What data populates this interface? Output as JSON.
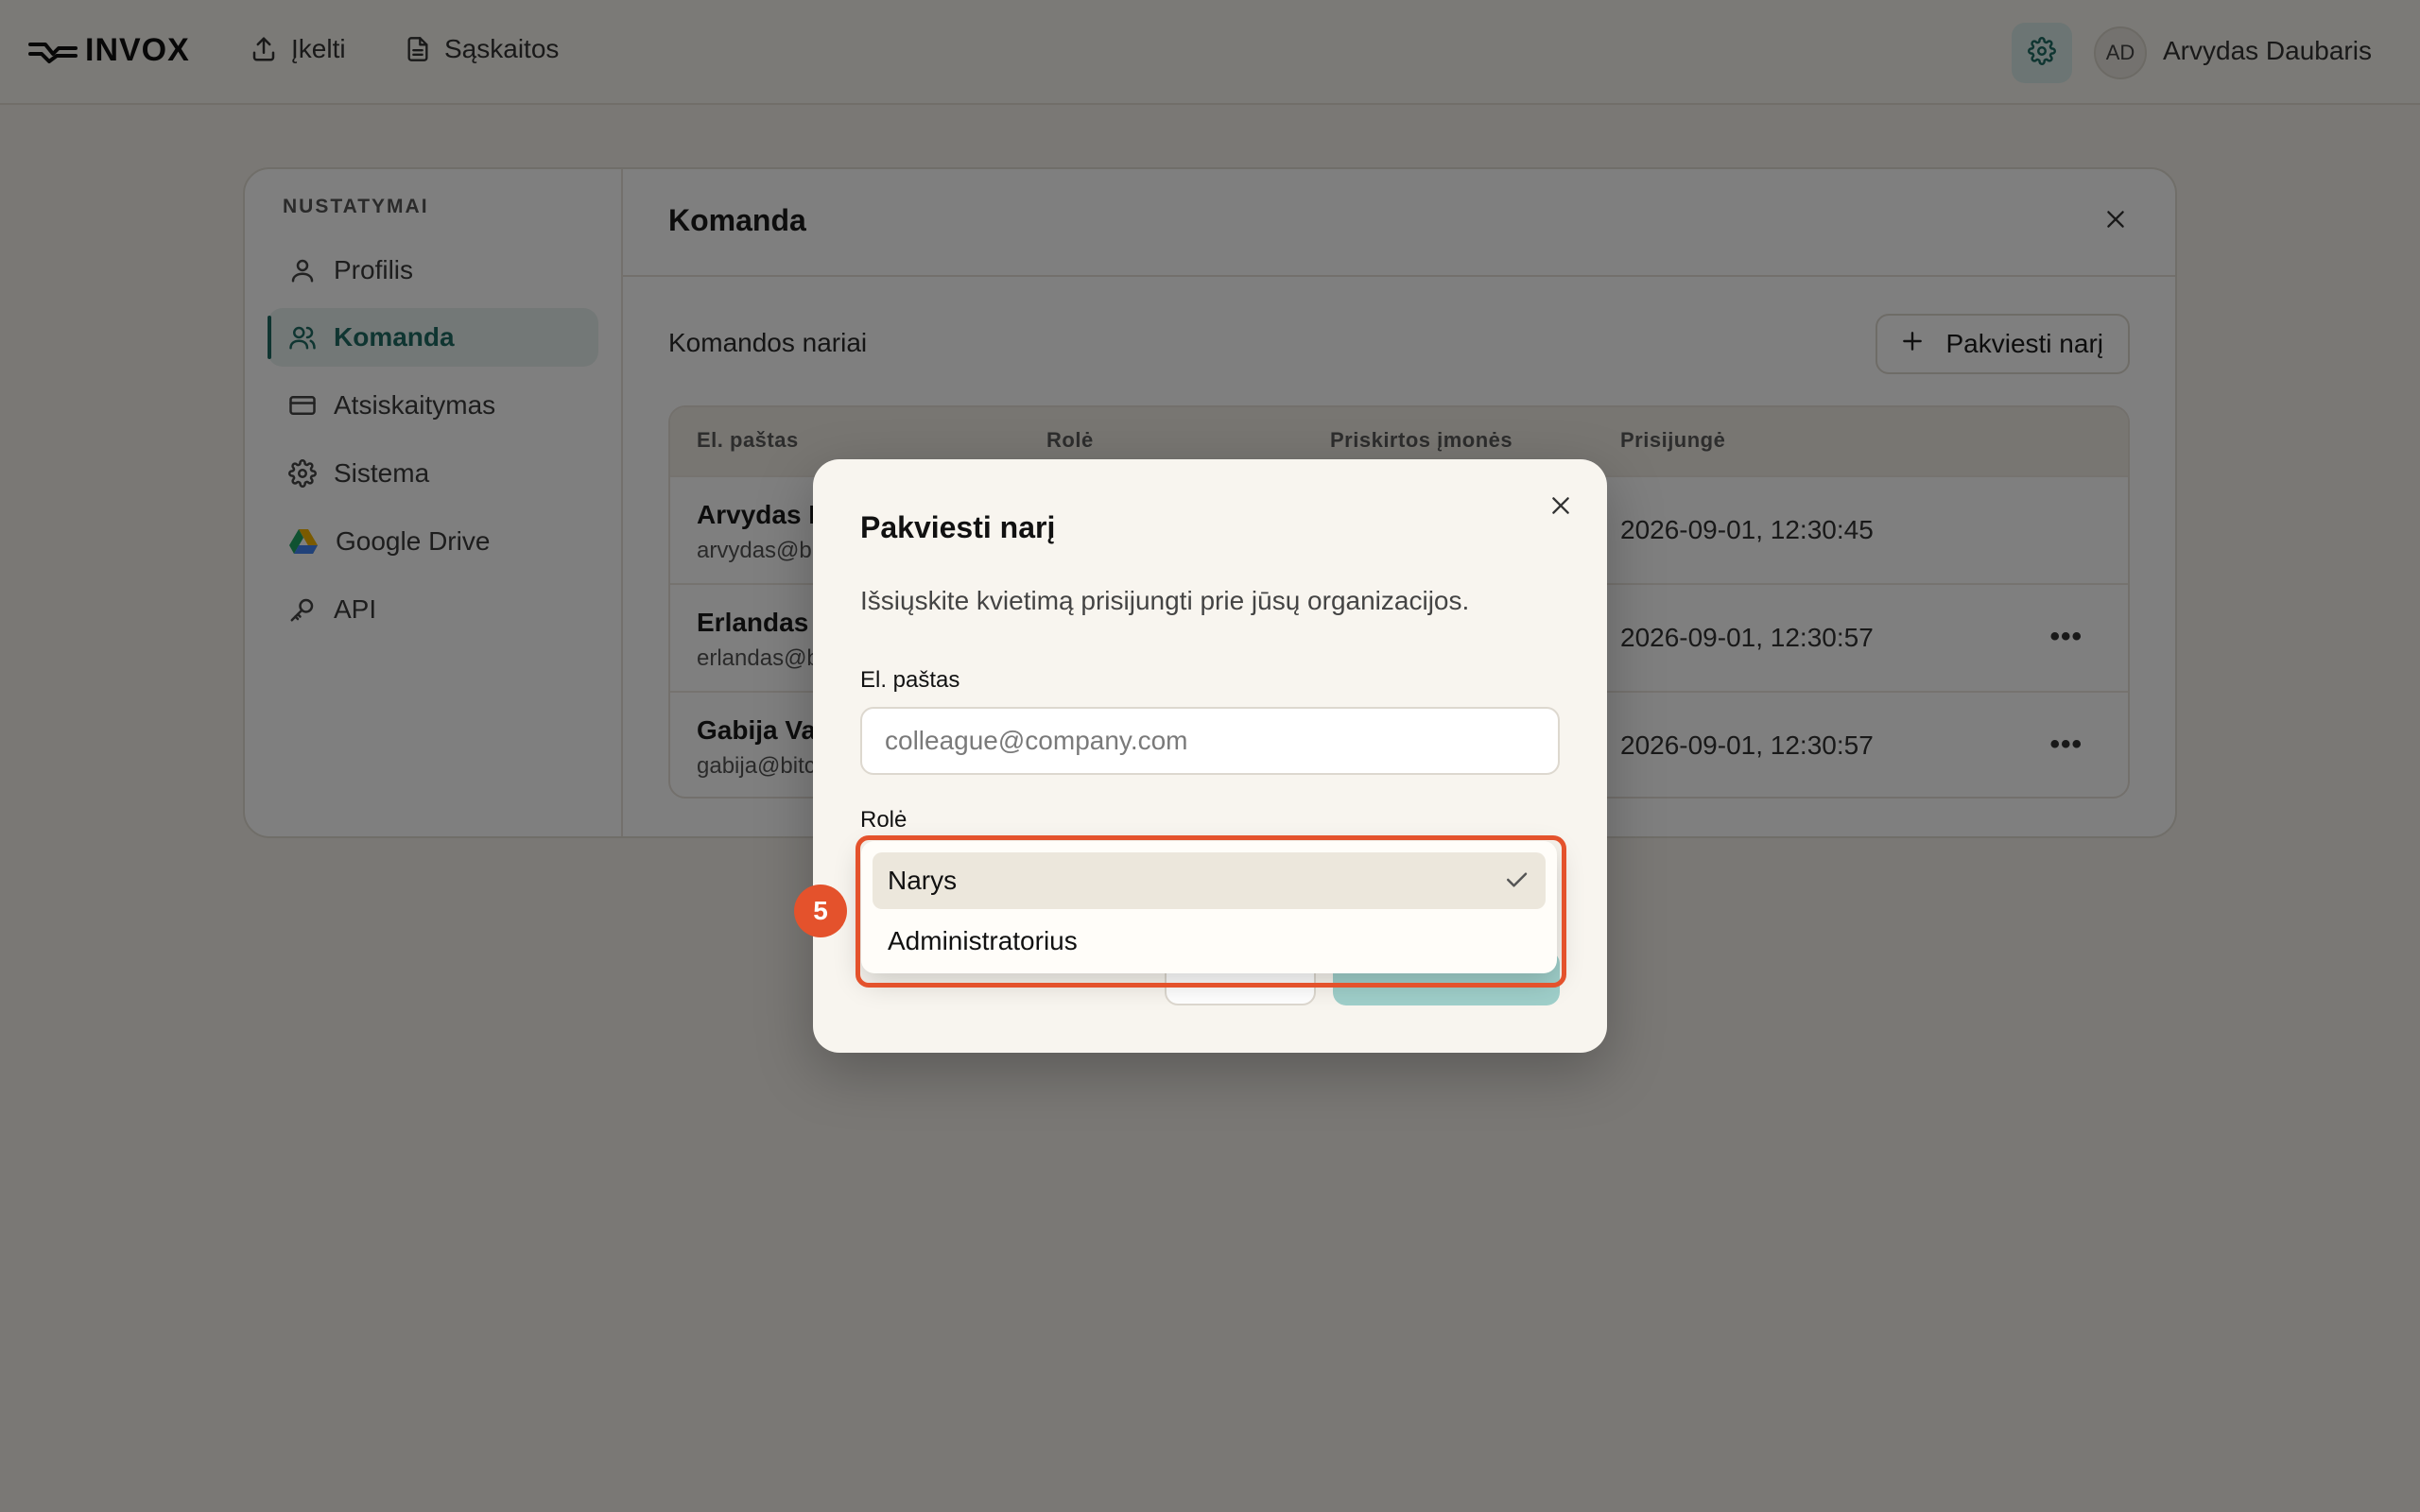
{
  "header": {
    "logo_text": "INVOX",
    "nav": [
      {
        "label": "Įkelti",
        "icon": "upload-icon"
      },
      {
        "label": "Sąskaitos",
        "icon": "document-icon"
      }
    ],
    "avatar_initials": "AD",
    "user_name": "Arvydas Daubaris"
  },
  "sidebar": {
    "title": "NUSTATYMAI",
    "items": [
      {
        "label": "Profilis",
        "icon": "user-icon"
      },
      {
        "label": "Komanda",
        "icon": "users-icon",
        "active": true
      },
      {
        "label": "Atsiskaitymas",
        "icon": "credit-card-icon"
      },
      {
        "label": "Sistema",
        "icon": "gear-icon"
      },
      {
        "label": "Google Drive",
        "icon": "google-drive-icon"
      },
      {
        "label": "API",
        "icon": "key-icon"
      }
    ]
  },
  "content": {
    "title": "Komanda",
    "members_title": "Komandos nariai",
    "invite_button": "Pakviesti narį",
    "table": {
      "columns": [
        "El. paštas",
        "Rolė",
        "Priskirtos įmonės",
        "Prisijungė"
      ],
      "rows": [
        {
          "name": "Arvydas D",
          "email": "arvydas@b",
          "last_login": "2026-09-01, 12:30:45",
          "has_menu": false
        },
        {
          "name": "Erlandas T",
          "email": "erlandas@b",
          "last_login": "2026-09-01, 12:30:57",
          "has_menu": true
        },
        {
          "name": "Gabija Va",
          "email": "gabija@bitc",
          "last_login": "2026-09-01, 12:30:57",
          "has_menu": true
        }
      ],
      "more_glyph": "•••"
    }
  },
  "modal": {
    "title": "Pakviesti narį",
    "description": "Išsiųskite kvietimą prisijungti prie jūsų organizacijos.",
    "email_label": "El. paštas",
    "email_placeholder": "colleague@company.com",
    "email_value": "",
    "role_label": "Rolė",
    "role_options": [
      "Narys",
      "Administratorius"
    ],
    "role_selected": "Narys"
  },
  "annotation": {
    "step_number": "5",
    "color": "#e4522c"
  },
  "colors": {
    "accent": "#1f6b63",
    "accent_bg": "#e7f0ee",
    "submit_disabled": "#9fcfca"
  }
}
